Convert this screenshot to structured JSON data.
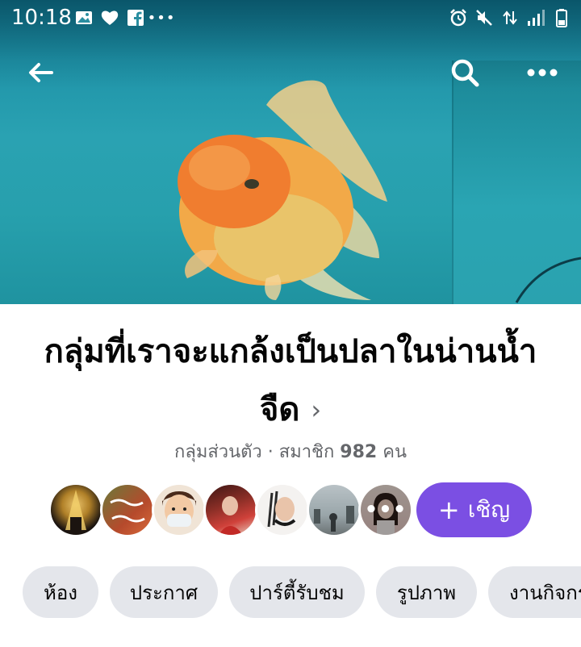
{
  "status_bar": {
    "time": "10:18",
    "left_icons": [
      "image-icon",
      "heart-icon",
      "facebook-icon",
      "more-icon"
    ],
    "right_icons": [
      "alarm-icon",
      "mute-icon",
      "data-arrows-icon",
      "signal-icon",
      "battery-icon"
    ]
  },
  "cover": {
    "back_icon": "arrow-left-icon",
    "search_icon": "search-icon",
    "more_icon": "more-horizontal-icon"
  },
  "group": {
    "name_line1": "กลุ่มที่เราจะแกล้งเป็นปลาในน่านน้ำ",
    "name_line2": "จืด",
    "chevron": "›",
    "privacy": "กลุ่มส่วนตัว",
    "separator": " · ",
    "members_prefix": "สมาชิก ",
    "member_count": "982",
    "members_suffix": " คน",
    "more_members": "•••"
  },
  "invite": {
    "plus": "+",
    "label": "เชิญ"
  },
  "chips": [
    {
      "label": "ห้อง"
    },
    {
      "label": "ประกาศ"
    },
    {
      "label": "ปาร์ตี้รับชม"
    },
    {
      "label": "รูปภาพ"
    },
    {
      "label": "งานกิจกรรม"
    }
  ],
  "colors": {
    "accent": "#7b4fe3",
    "chip_bg": "#e4e6eb",
    "secondary_text": "#65676b"
  }
}
